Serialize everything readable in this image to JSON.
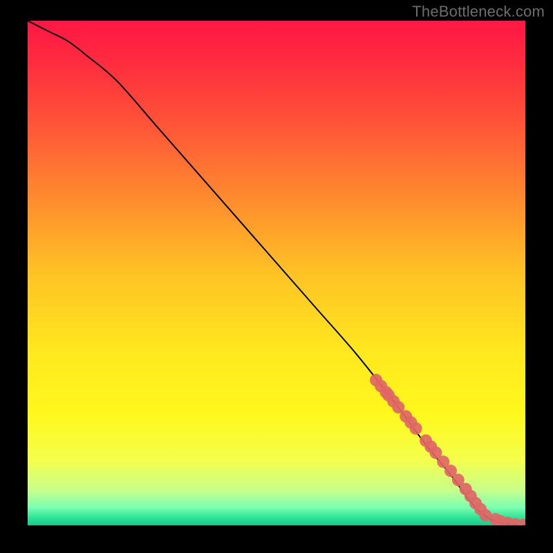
{
  "attribution": "TheBottleneck.com",
  "chart_data": {
    "type": "line",
    "title": "",
    "xlabel": "",
    "ylabel": "",
    "xlim": [
      0,
      100
    ],
    "ylim": [
      0,
      100
    ],
    "background_gradient": {
      "stops": [
        {
          "offset": 0.0,
          "color": "#ff1744"
        },
        {
          "offset": 0.08,
          "color": "#ff2b3f"
        },
        {
          "offset": 0.2,
          "color": "#ff5238"
        },
        {
          "offset": 0.35,
          "color": "#ff8a2e"
        },
        {
          "offset": 0.5,
          "color": "#ffc225"
        },
        {
          "offset": 0.65,
          "color": "#ffe71f"
        },
        {
          "offset": 0.78,
          "color": "#fff81c"
        },
        {
          "offset": 0.87,
          "color": "#f4ff4a"
        },
        {
          "offset": 0.93,
          "color": "#c8ff8a"
        },
        {
          "offset": 0.965,
          "color": "#7affb0"
        },
        {
          "offset": 0.985,
          "color": "#2de396"
        },
        {
          "offset": 1.0,
          "color": "#18c98a"
        }
      ]
    },
    "curve": {
      "x": [
        0,
        4,
        8,
        12,
        18,
        26,
        34,
        42,
        50,
        58,
        66,
        74,
        80,
        85,
        88,
        90,
        92,
        94,
        96,
        98,
        100
      ],
      "y": [
        100,
        98,
        96,
        93,
        88,
        79,
        70,
        61,
        52,
        43,
        34,
        24,
        16,
        10,
        6,
        3.5,
        1.8,
        0.8,
        0.3,
        0.1,
        0.05
      ]
    },
    "series": [
      {
        "name": "markers",
        "color": "#e06666",
        "x": [
          70,
          71,
          72,
          72.5,
          73.5,
          74.5,
          76,
          77,
          78,
          80,
          81,
          82,
          83.5,
          85,
          86.5,
          88,
          89,
          90,
          91,
          92,
          94,
          95,
          96.5,
          98,
          99.5
        ],
        "y": [
          28.8,
          27.6,
          26.4,
          25.8,
          24.6,
          23.4,
          21.6,
          20.4,
          19.2,
          16.8,
          15.6,
          14.4,
          12.6,
          10.8,
          9.0,
          7.2,
          5.8,
          4.4,
          3.2,
          2.0,
          1.2,
          0.8,
          0.45,
          0.2,
          0.08
        ]
      }
    ]
  }
}
